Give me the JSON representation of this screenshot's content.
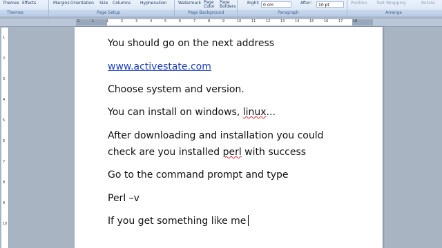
{
  "ribbon": {
    "top_items": {
      "themes": "Themes",
      "effects": "Effects",
      "margins": "Margins",
      "orientation": "Orientation",
      "size": "Size",
      "columns": "Columns",
      "hyphenation": "Hyphenation",
      "watermark": "Watermark",
      "page_color": "Page\nColor",
      "page_borders": "Page\nBorders",
      "right_label": "Right:",
      "right_value": "0 cm",
      "after_label": "After:",
      "after_value": "10 pt",
      "position": "Position",
      "text_wrapping": "Text Wrapping",
      "rotate": "Rotate"
    },
    "groups": {
      "themes": "Themes",
      "page_setup": "Page Setup",
      "page_background": "Page Background",
      "paragraph": "Paragraph",
      "arrange": "Arrange"
    }
  },
  "ruler": {
    "h_numbers": [
      "2",
      "1",
      "1",
      "2",
      "3",
      "4",
      "5",
      "6",
      "7",
      "8",
      "9",
      "10",
      "11",
      "12",
      "13",
      "14",
      "15",
      "16",
      "17",
      "18"
    ],
    "v_numbers": [
      "1",
      "2",
      "3",
      "4",
      "5",
      "6",
      "7",
      "8",
      "9",
      "10"
    ]
  },
  "document": {
    "lines": [
      "You should go on the next address",
      "www.activestate.com",
      "Choose system and version.",
      "You can install on windows, ",
      "linux",
      "...",
      "After downloading and installation you could",
      "check are you installed ",
      "perl",
      " with success",
      "Go to the command prompt and type",
      "Perl –v",
      "If you get something like me"
    ]
  }
}
